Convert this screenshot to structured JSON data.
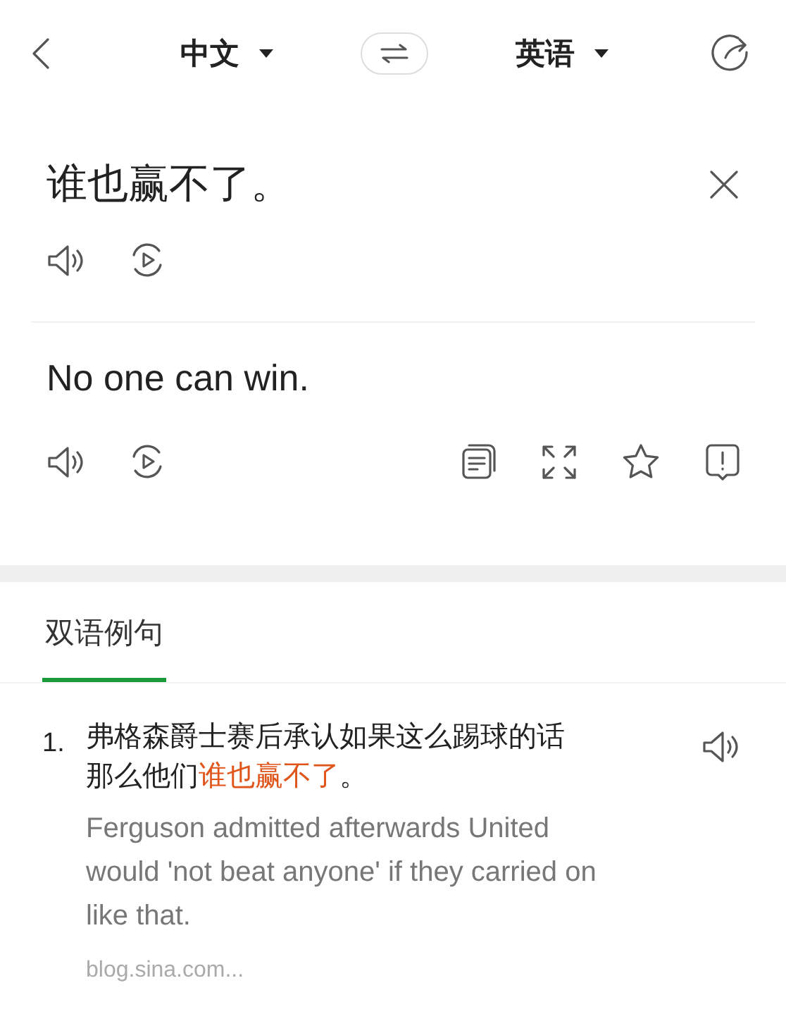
{
  "header": {
    "source_language": "中文",
    "target_language": "英语"
  },
  "source": {
    "text": "谁也赢不了。"
  },
  "translation": {
    "text": "No one can win."
  },
  "tabs": [
    {
      "label": "双语例句",
      "selected": true
    }
  ],
  "examples": [
    {
      "number": "1.",
      "zh_parts": [
        {
          "text": "弗格森爵士赛后承认如果这么踢球的话那么他们",
          "highlight": false
        },
        {
          "text": "谁也赢不了",
          "highlight": true
        },
        {
          "text": "。",
          "highlight": false
        }
      ],
      "en": "Ferguson admitted afterwards United would 'not beat anyone' if they carried on like that.",
      "source": "blog.sina.com..."
    }
  ]
}
